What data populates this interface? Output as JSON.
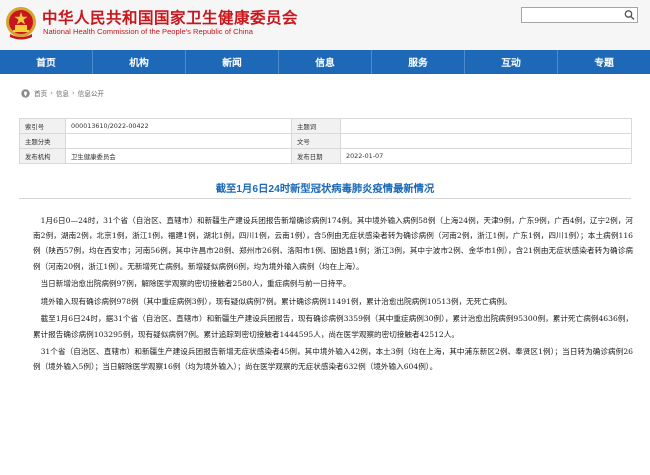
{
  "header": {
    "site_name_zh": "中华人民共和国国家卫生健康委员会",
    "site_name_en": "National Health Commission of the People's Republic of China",
    "brand_color": "#c8161d"
  },
  "nav": {
    "color": "#1d69b7",
    "items": [
      {
        "label": "首页"
      },
      {
        "label": "机构"
      },
      {
        "label": "新闻"
      },
      {
        "label": "信息"
      },
      {
        "label": "服务"
      },
      {
        "label": "互动"
      },
      {
        "label": "专题"
      }
    ]
  },
  "breadcrumb": [
    "首页",
    "信息",
    "信息公开"
  ],
  "meta": {
    "index_no_label": "索引号",
    "index_no_value": "000013610/2022-00422",
    "subject_label": "主题词",
    "subject_value": "",
    "category_label": "主题分类",
    "category_value": "",
    "doc_no_label": "文号",
    "doc_no_value": "",
    "issuer_label": "发布机构",
    "issuer_value": "卫生健康委员会",
    "date_label": "发布日期",
    "date_value": "2022-01-07"
  },
  "article": {
    "title": "截至1月6日24时新型冠状病毒肺炎疫情最新情况",
    "paragraphs": [
      "1月6日0—24时，31个省（自治区、直辖市）和新疆生产建设兵团报告新增确诊病例174例。其中境外输入病例58例（上海24例，天津9例，广东9例，广西4例，辽宁2例，河南2例，湖南2例，北京1例，浙江1例，福建1例，湖北1例，四川1例，云南1例），含5例由无症状感染者转为确诊病例（河南2例，浙江1例，广东1例，四川1例）；本土病例116例（陕西57例，均在西安市；河南56例，其中许昌市28例、郑州市26例、洛阳市1例、固始县1例；浙江3例，其中宁波市2例、金华市1例），含21例由无症状感染者转为确诊病例（河南20例，浙江1例）。无新增死亡病例。新增疑似病例6例，均为境外输入病例（均在上海）。",
      "当日新增治愈出院病例97例，解除医学观察的密切接触者2580人，重症病例与前一日持平。",
      "境外输入现有确诊病例978例（其中重症病例3例），现有疑似病例7例。累计确诊病例11491例，累计治愈出院病例10513例，无死亡病例。",
      "截至1月6日24时，据31个省（自治区、直辖市）和新疆生产建设兵团报告，现有确诊病例3359例（其中重症病例30例），累计治愈出院病例95300例，累计死亡病例4636例，累计报告确诊病例103295例，现有疑似病例7例。累计追踪到密切接触者1444595人，尚在医学观察的密切接触者42512人。",
      "31个省（自治区、直辖市）和新疆生产建设兵团报告新增无症状感染者45例，其中境外输入42例，本土3例（均在上海，其中浦东新区2例、奉贤区1例）；当日转为确诊病例26例（境外输入5例）；当日解除医学观察16例（均为境外输入）；尚在医学观察的无症状感染者632例（境外输入604例）。"
    ]
  }
}
